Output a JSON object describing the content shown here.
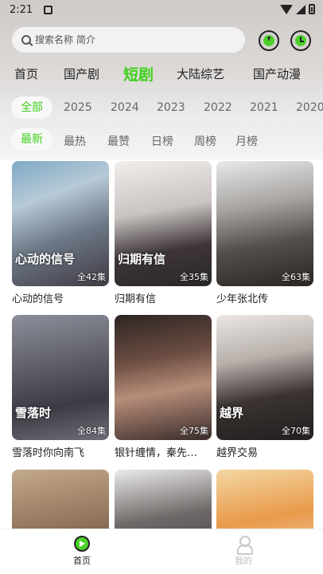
{
  "status_bar": {
    "time": "2:21"
  },
  "search": {
    "placeholder": "搜索名称 简介"
  },
  "top_tabs": [
    "首页",
    "国产剧",
    "短剧",
    "大陆综艺",
    "国产动漫"
  ],
  "top_tabs_active": "短剧",
  "year_filters": [
    "全部",
    "2025",
    "2024",
    "2023",
    "2022",
    "2021",
    "2020"
  ],
  "year_active": "全部",
  "sort_filters": [
    "最新",
    "最热",
    "最赞",
    "日榜",
    "周榜",
    "月榜"
  ],
  "sort_active": "最新",
  "grid": [
    {
      "title": "心动的信号",
      "poster_text": "心动的信号",
      "episodes": "全42集"
    },
    {
      "title": "归期有信",
      "poster_text": "归期有信",
      "episodes": "全35集"
    },
    {
      "title": "少年张北传",
      "poster_text": "",
      "episodes": "全63集"
    },
    {
      "title": "雪落时你向南飞",
      "poster_text": "雪落时",
      "episodes": "全84集"
    },
    {
      "title": "银针缠情，秦先…",
      "poster_text": "",
      "episodes": "全75集"
    },
    {
      "title": "越界交易",
      "poster_text": "越界",
      "episodes": "全70集"
    },
    {
      "title": "",
      "poster_text": "",
      "episodes": ""
    },
    {
      "title": "",
      "poster_text": "",
      "episodes": ""
    },
    {
      "title": "",
      "poster_text": "",
      "episodes": ""
    }
  ],
  "bottom_nav": {
    "home": "首页",
    "mine": "我的"
  },
  "colors": {
    "accent": "#3fd01c"
  }
}
